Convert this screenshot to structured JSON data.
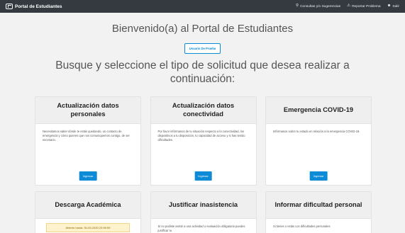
{
  "navbar": {
    "brand": "Portal de Estudiantes",
    "links": [
      {
        "label": "Consultas y/o Sugerencias",
        "icon": "map-marker-icon"
      },
      {
        "label": "Reportar Problema",
        "icon": "warning-icon"
      },
      {
        "label": "Salir",
        "icon": "user-icon"
      }
    ]
  },
  "welcome": "Bienvenido(a) al Portal de Estudiantes",
  "user_button": "Usuario De Prueba",
  "subtitle": "Busque y seleccione el tipo de solicitud que desea realizar a continuación:",
  "cards": [
    {
      "title": "Actualización datos personales",
      "text": "Necesitamos saber dónde te estás quedando, un contacto de emergencia y cómo quieres que nos comuniquemos contigo, de ser necesario.",
      "button": "Ingresar"
    },
    {
      "title": "Actualización datos conectividad",
      "text": "Por favor infórmanos de tu situación respecto a la conectividad, los dispositivos a tu disposición, tu capacidad de acceso y si has tenido dificultades.",
      "button": "Ingresar"
    },
    {
      "title": "Emergencia COVID-19",
      "text": "Infórmanos sobre tu estado en relación a la emergencia COVID-19.",
      "button": "Ingresar"
    },
    {
      "title": "Descarga Académica",
      "badge": "Abierto hasta: 30-09-2020 23:59:59",
      "text": ""
    },
    {
      "title": "Justificar inasistencia",
      "text": "Si no pudiste asistir a una actividad o evaluación obligatoria puedes justificar tu"
    },
    {
      "title": "Informar dificultad personal",
      "text": "Si tienes o estás con dificultades personales"
    }
  ]
}
